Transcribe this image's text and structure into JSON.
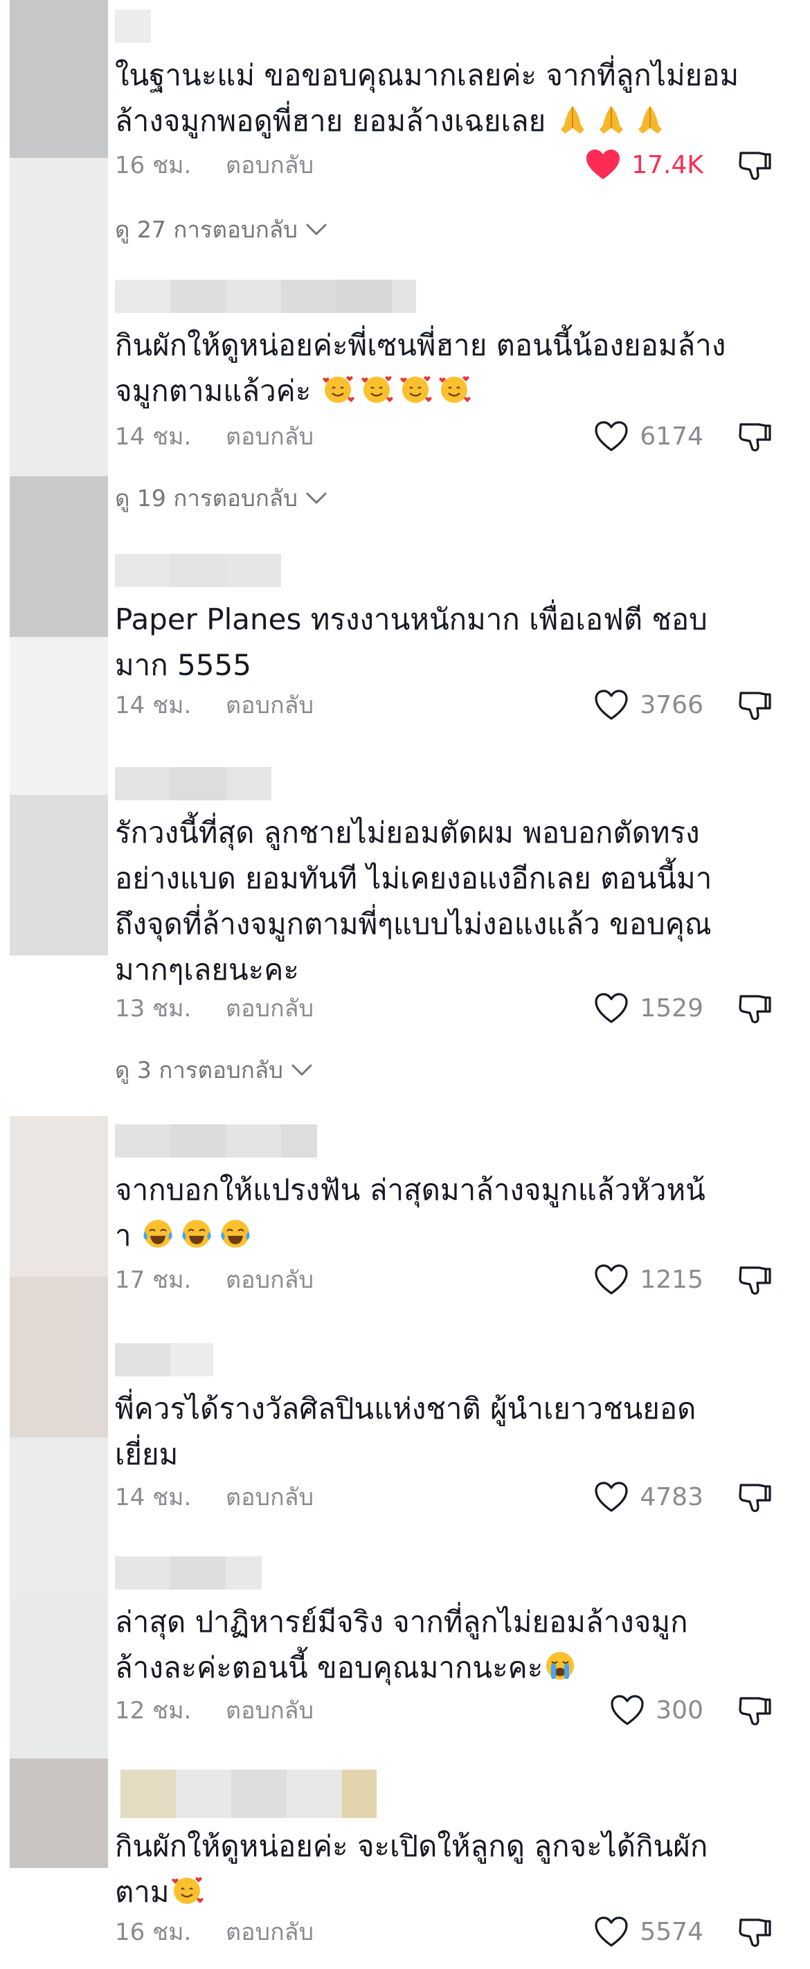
{
  "colors": {
    "accent": "#fe2c55",
    "secondary_text": "#8a8b91"
  },
  "labels": {
    "reply": "ตอบกลับ"
  },
  "comments": [
    {
      "text_lines": [
        "ในฐานะแม่ ขอขอบคุณมากเลยค่ะ จากที่ลูกไม่ยอม",
        "ล้างจมูกพอดูพี่ฮาย ยอมล้างเฉยเลย"
      ],
      "emoji": [
        "folded-hands",
        "folded-hands",
        "folded-hands"
      ],
      "time": "16 ชม.",
      "likes": "17.4K",
      "liked": true,
      "view_replies": "ดู 27 การตอบกลับ"
    },
    {
      "text_lines": [
        "กินผักให้ดูหน่อยค่ะพี่เซนพี่ฮาย ตอนนี้น้องยอมล้าง",
        "จมูกตามแล้วค่ะ"
      ],
      "emoji": [
        "smiling-face-with-hearts",
        "smiling-face-with-hearts",
        "smiling-face-with-hearts",
        "smiling-face-with-hearts"
      ],
      "time": "14 ชม.",
      "likes": "6174",
      "liked": false,
      "view_replies": "ดู 19 การตอบกลับ"
    },
    {
      "text_lines": [
        "Paper Planes ทรงงานหนักมาก เพื่อเอฟตี ชอบ",
        "มาก 5555"
      ],
      "emoji": [],
      "time": "14 ชม.",
      "likes": "3766",
      "liked": false,
      "view_replies": ""
    },
    {
      "text_lines": [
        "รักวงนี้ที่สุด ลูกชายไม่ยอมตัดผม พอบอกตัดทรง",
        "อย่างแบด ยอมทันที ไม่เคยงอแงอีกเลย ตอนนี้มา",
        "ถึงจุดที่ล้างจมูกตามพี่ๆแบบไม่งอแงแล้ว ขอบคุณ",
        "มากๆเลยนะคะ"
      ],
      "emoji": [],
      "time": "13 ชม.",
      "likes": "1529",
      "liked": false,
      "view_replies": "ดู 3 การตอบกลับ"
    },
    {
      "text_lines": [
        "จากบอกให้แปรงฟัน ล่าสุดมาล้างจมูกแล้วหัวหน้",
        "า"
      ],
      "emoji": [
        "face-with-tears-of-joy",
        "face-with-tears-of-joy",
        "face-with-tears-of-joy"
      ],
      "time": "17 ชม.",
      "likes": "1215",
      "liked": false,
      "view_replies": ""
    },
    {
      "text_lines": [
        "พี่ควรได้รางวัลศิลปินแห่งชาติ ผู้นำเยาวชนยอด",
        "เยี่ยม"
      ],
      "emoji": [],
      "time": "14 ชม.",
      "likes": "4783",
      "liked": false,
      "view_replies": ""
    },
    {
      "text_lines": [
        "ล่าสุด ปาฏิหารย์มีจริง จากที่ลูกไม่ยอมล้างจมูก",
        "ล้างละค่ะตอนนี้ ขอบคุณมากนะคะ"
      ],
      "emoji": [
        "loudly-crying-face"
      ],
      "time": "12 ชม.",
      "likes": "300",
      "liked": false,
      "view_replies": ""
    },
    {
      "text_lines": [
        "กินผักให้ดูหน่อยค่ะ จะเปิดให้ลูกดู ลูกจะได้กินผัก",
        "ตาม"
      ],
      "emoji": [
        "smiling-face-with-hearts"
      ],
      "time": "16 ชม.",
      "likes": "5574",
      "liked": false,
      "view_replies": ""
    }
  ]
}
